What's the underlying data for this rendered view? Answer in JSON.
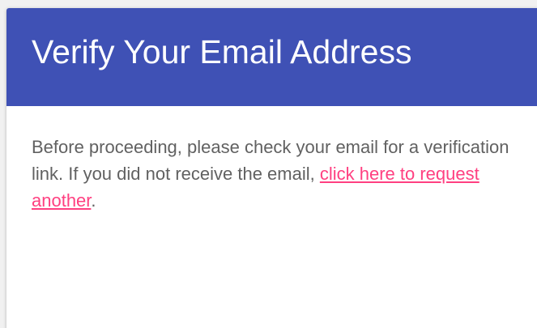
{
  "card": {
    "title": "Verify Your Email Address",
    "message_before": "Before proceeding, please check your email for a verification link. If you did not receive the email, ",
    "resend_link_label": "click here to request another",
    "message_after": "."
  },
  "colors": {
    "header_bg": "#3f51b5",
    "header_text": "#ffffff",
    "body_text": "#616161",
    "link": "#ff4081"
  }
}
